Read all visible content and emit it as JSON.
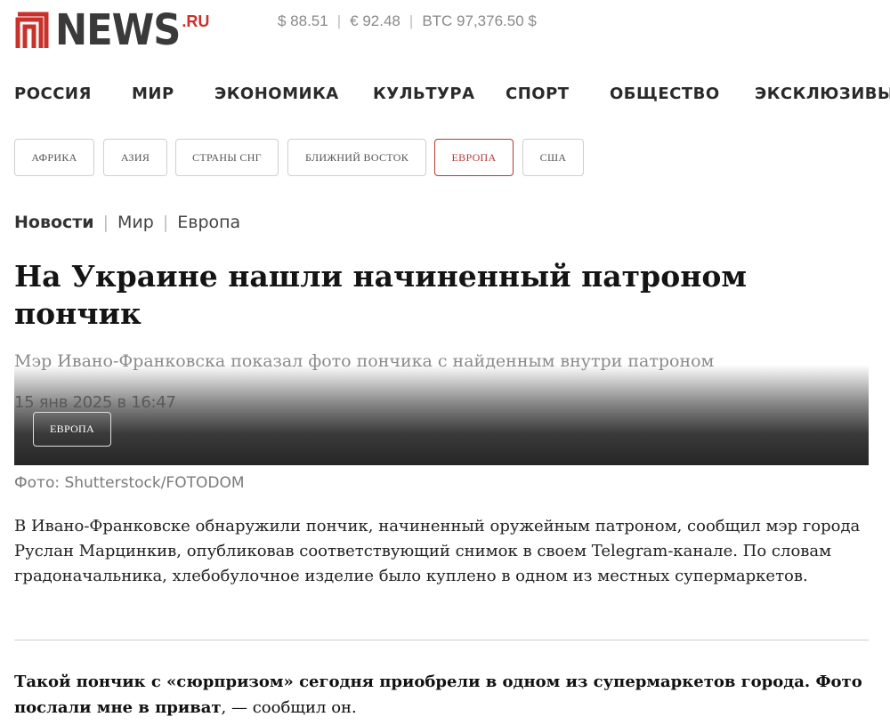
{
  "header": {
    "logo_text": "NEWS",
    "logo_suffix": ".RU",
    "brand_color": "#c8322b",
    "rates": [
      "$ 88.51",
      "€ 92.48",
      "BTC 97,376.50 $"
    ]
  },
  "main_nav": [
    "РОССИЯ",
    "МИР",
    "ЭКОНОМИКА",
    "КУЛЬТУРА",
    "СПОРТ",
    "ОБЩЕСТВО",
    "ЭКСКЛЮЗИВЫ"
  ],
  "sub_nav": {
    "items": [
      "АФРИКА",
      "АЗИЯ",
      "СТРАНЫ СНГ",
      "БЛИЖНИЙ ВОСТОК",
      "ЕВРОПА",
      "США"
    ],
    "active": "ЕВРОПА"
  },
  "breadcrumb": [
    "Новости",
    "Мир",
    "Европа"
  ],
  "article": {
    "title": "На Украине нашли начиненный патроном пончик",
    "lead": "Мэр Ивано-Франковска показал фото пончика с найденным внутри патроном",
    "date": "15 янв 2025 в 16:47",
    "category_badge": "ЕВРОПА",
    "photo_credit": "Фото: Shutterstock/FOTODOM",
    "body": "В Ивано-Франковске обнаружили пончик, начиненный оружейным патроном, сообщил мэр города Руслан Марцинкив, опубликовав соответствующий снимок в своем Telegram-канале. По словам градоначальника, хлебобулочное изделие было куплено в одном из местных супермаркетов.",
    "quote_bold": "Такой пончик с «сюрпризом» сегодня приобрели в одном из супермаркетов города. Фото послали мне в приват",
    "quote_tail": ", — сообщил он."
  }
}
